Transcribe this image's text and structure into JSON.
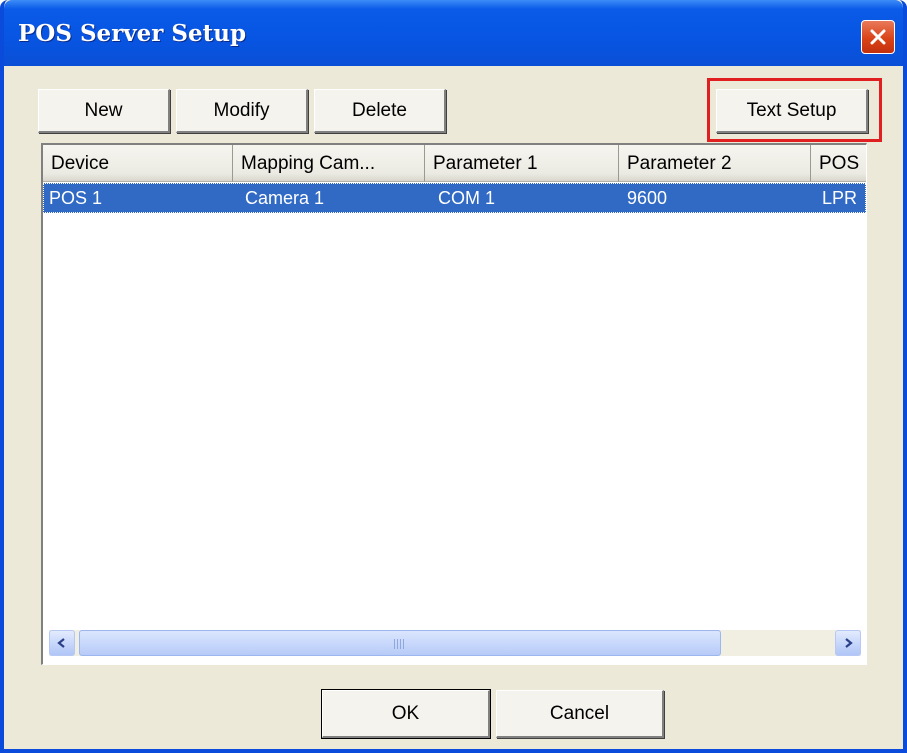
{
  "window": {
    "title": "POS Server Setup",
    "close_icon": "close-x-icon"
  },
  "toolbar": {
    "new_label": "New",
    "modify_label": "Modify",
    "delete_label": "Delete",
    "text_setup_label": "Text Setup"
  },
  "table": {
    "columns": [
      "Device",
      "Mapping Cam...",
      "Parameter 1",
      "Parameter 2",
      "POS"
    ],
    "rows": [
      [
        "POS 1",
        "Camera 1",
        "COM 1",
        "9600",
        "LPR"
      ]
    ],
    "selected_row": 0
  },
  "scrollbar": {
    "left_icon": "chevron-left-icon",
    "right_icon": "chevron-right-icon"
  },
  "footer": {
    "ok_label": "OK",
    "cancel_label": "Cancel"
  },
  "colors": {
    "titlebar": "#0755e2",
    "selection": "#316ac5",
    "highlight": "#e02020",
    "close_button": "#d94318"
  }
}
